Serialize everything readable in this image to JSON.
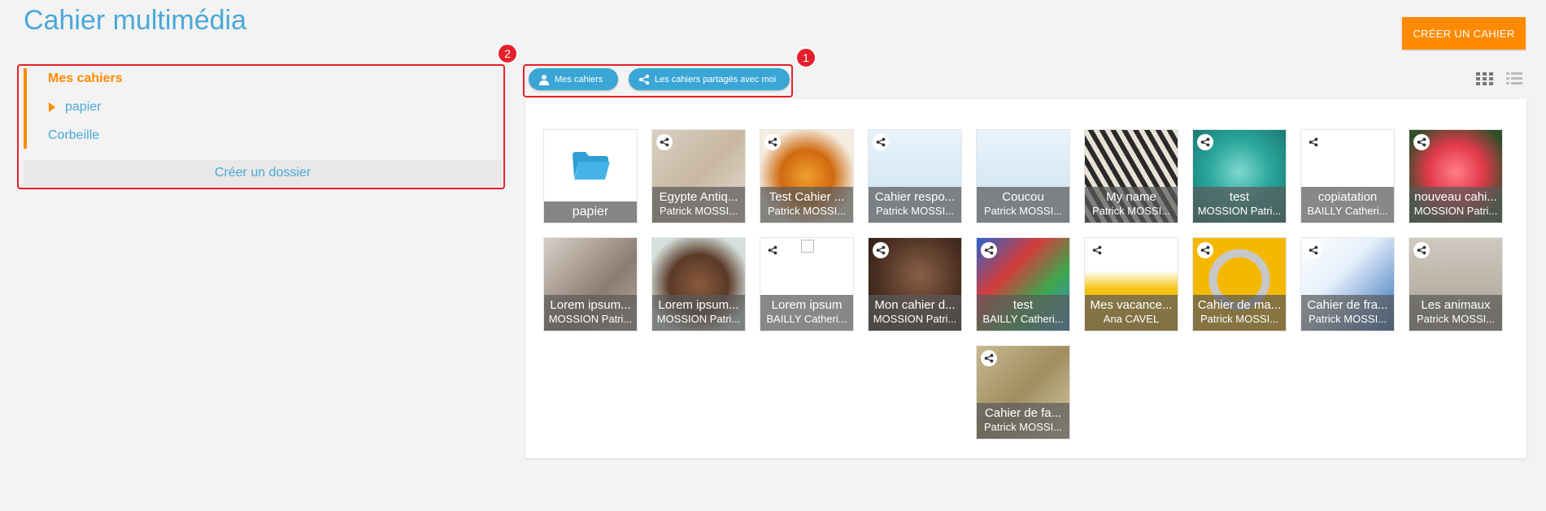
{
  "header": {
    "title": "Cahier multimédia",
    "create_label": "CRÉER UN CAHIER"
  },
  "sidebar": {
    "items": [
      {
        "label": "Mes cahiers",
        "active": true
      },
      {
        "label": "papier",
        "expandable": true
      },
      {
        "label": "Corbeille"
      }
    ],
    "create_folder_label": "Créer un dossier",
    "badge": "2"
  },
  "filters": {
    "mine_label": "Mes cahiers",
    "shared_label": "Les cahiers partagés avec moi",
    "badge": "1"
  },
  "view_toggle": {
    "grid_icon": "grid-icon",
    "list_icon": "list-icon"
  },
  "colors": {
    "accent": "#ff8a00",
    "primary": "#4aa8d8",
    "annotation": "#e5202a"
  },
  "tiles": [
    {
      "kind": "folder",
      "title": "papier"
    },
    {
      "title": "Egypte Antiq...",
      "author": "Patrick MOSSI...",
      "shared": true,
      "theme": "letters"
    },
    {
      "title": "Test Cahier ...",
      "author": "Patrick MOSSI...",
      "shared": true,
      "theme": "autumn"
    },
    {
      "title": "Cahier respo...",
      "author": "Patrick MOSSI...",
      "shared": true,
      "theme": "cartoon"
    },
    {
      "title": "Coucou",
      "author": "Patrick MOSSI...",
      "shared": false,
      "theme": "cartoon"
    },
    {
      "title": "My name",
      "author": "Patrick MOSSI...",
      "shared": false,
      "theme": "zebra"
    },
    {
      "title": "test",
      "author": "MOSSION Patri...",
      "shared": true,
      "theme": "teal"
    },
    {
      "title": "copiatation",
      "author": "BAILLY Catheri...",
      "shared": true,
      "theme": "music"
    },
    {
      "title": "nouveau cahi...",
      "author": "MOSSION Patri...",
      "shared": true,
      "theme": "rose"
    },
    {
      "title": "Lorem ipsum...",
      "author": "MOSSION Patri...",
      "shared": false,
      "theme": "spoon"
    },
    {
      "title": "Lorem ipsum...",
      "author": "MOSSION Patri...",
      "shared": false,
      "theme": "cakes"
    },
    {
      "title": "Lorem ipsum",
      "author": "BAILLY Catheri...",
      "shared": true,
      "theme": "broken"
    },
    {
      "title": "Mon cahier d...",
      "author": "MOSSION Patri...",
      "shared": true,
      "theme": "face"
    },
    {
      "title": "test",
      "author": "BAILLY Catheri...",
      "shared": true,
      "theme": "houses"
    },
    {
      "title": "Mes vacance...",
      "author": "Ana CAVEL",
      "shared": true,
      "theme": "bucket"
    },
    {
      "title": "Cahier de ma...",
      "author": "Patrick MOSSI...",
      "shared": true,
      "theme": "one"
    },
    {
      "title": "Cahier de fra...",
      "author": "Patrick MOSSI...",
      "shared": true,
      "theme": "book"
    },
    {
      "title": "Les animaux",
      "author": "Patrick MOSSI...",
      "shared": true,
      "theme": "ducks"
    },
    {
      "title": "Cahier de fa...",
      "author": "Patrick MOSSI...",
      "shared": true,
      "theme": "crow"
    }
  ]
}
